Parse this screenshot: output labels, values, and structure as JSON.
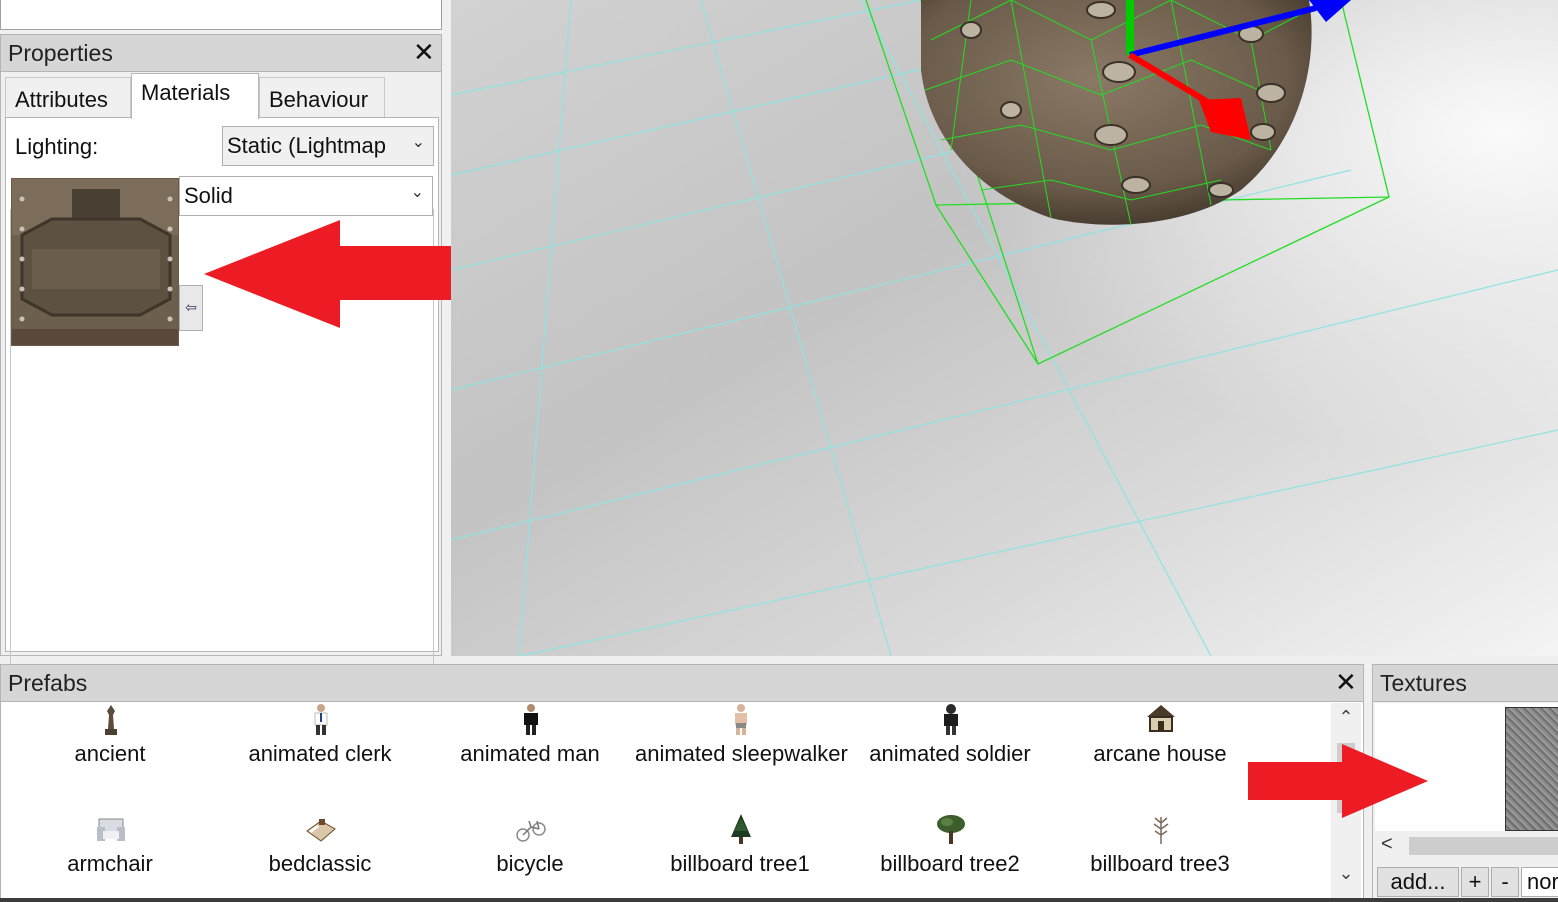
{
  "properties": {
    "title": "Properties",
    "close_label": "✕",
    "tabs": [
      {
        "label": "Attributes"
      },
      {
        "label": "Materials"
      },
      {
        "label": "Behaviour"
      }
    ],
    "active_tab": "Materials",
    "lighting": {
      "label": "Lighting:",
      "value": "Static (Lightmap"
    },
    "material": {
      "mode": "Solid",
      "apply_icon": "⇦"
    }
  },
  "viewport": {
    "gizmo_colors": {
      "x": "#ff0000",
      "y": "#00cc00",
      "z": "#0000ff"
    },
    "grid_color": "#8fe3e3",
    "bbox_color": "#22dd22"
  },
  "prefabs": {
    "title": "Prefabs",
    "close_label": "✕",
    "items": [
      {
        "label": "ancient",
        "icon": "statue-icon"
      },
      {
        "label": "animated clerk",
        "icon": "clerk-figure-icon"
      },
      {
        "label": "animated man",
        "icon": "man-figure-icon"
      },
      {
        "label": "animated sleepwalker",
        "icon": "sleepwalker-figure-icon"
      },
      {
        "label": "animated soldier",
        "icon": "soldier-figure-icon"
      },
      {
        "label": "arcane house",
        "icon": "house-icon"
      },
      {
        "label": "armchair",
        "icon": "armchair-icon"
      },
      {
        "label": "bedclassic",
        "icon": "bed-icon"
      },
      {
        "label": "bicycle",
        "icon": "bicycle-icon"
      },
      {
        "label": "billboard tree1",
        "icon": "pine-tree-icon"
      },
      {
        "label": "billboard tree2",
        "icon": "round-tree-icon"
      },
      {
        "label": "billboard tree3",
        "icon": "bare-tree-icon"
      }
    ],
    "scroll_up": "⌃",
    "scroll_down": "⌄"
  },
  "textures": {
    "title": "Textures",
    "scroll_left": "<",
    "add_label": "add...",
    "plus_label": "+",
    "minus_label": "-",
    "filter_value": "nor"
  },
  "annotation_color": "#ed1c24"
}
